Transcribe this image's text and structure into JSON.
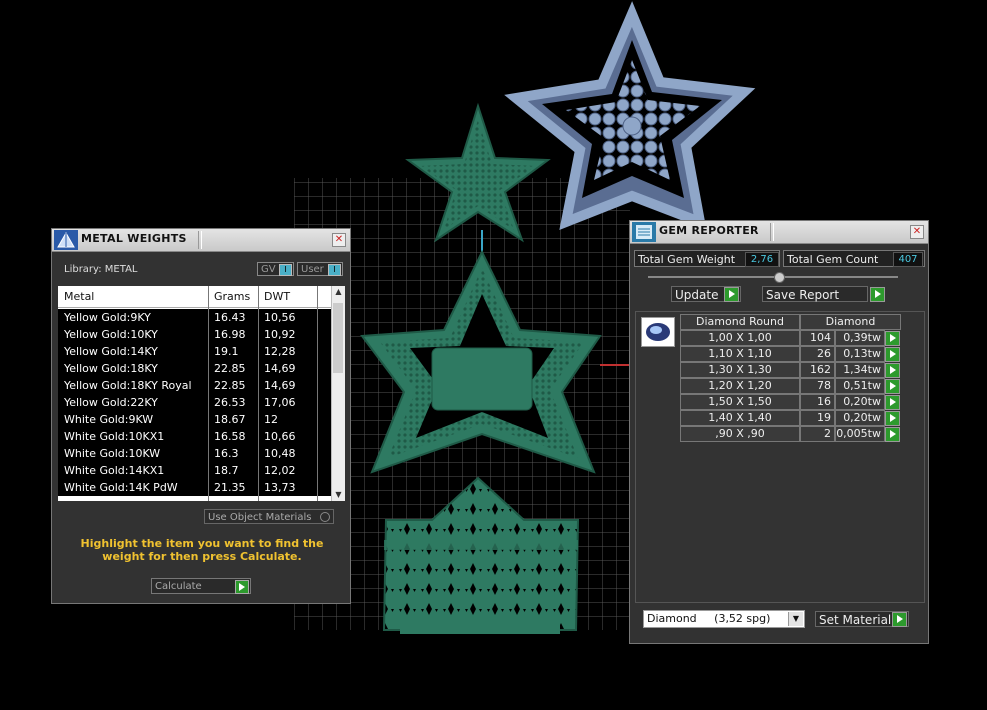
{
  "metal_weights": {
    "title": "METAL WEIGHTS",
    "library_label": "Library: METAL",
    "toggle_gv": "GV",
    "toggle_user": "User",
    "columns": [
      "Metal",
      "Grams",
      "DWT"
    ],
    "rows": [
      [
        "Yellow Gold:9KY",
        "16.43",
        "10,56"
      ],
      [
        "Yellow Gold:10KY",
        "16.98",
        "10,92"
      ],
      [
        "Yellow Gold:14KY",
        "19.1",
        "12,28"
      ],
      [
        "Yellow Gold:18KY",
        "22.85",
        "14,69"
      ],
      [
        "Yellow Gold:18KY Royal",
        "22.85",
        "14,69"
      ],
      [
        "Yellow Gold:22KY",
        "26.53",
        "17,06"
      ],
      [
        "White Gold:9KW",
        "18.67",
        "12"
      ],
      [
        "White Gold:10KX1",
        "16.58",
        "10,66"
      ],
      [
        "White Gold:10KW",
        "16.3",
        "10,48"
      ],
      [
        "White Gold:14KX1",
        "18.7",
        "12,02"
      ],
      [
        "White Gold:14K PdW",
        "21.35",
        "13,73"
      ]
    ],
    "use_object_materials": "Use Object Materials",
    "hint": "Highlight the item you want to find the weight for then press Calculate.",
    "calculate_label": "Calculate"
  },
  "gem_reporter": {
    "title": "GEM REPORTER",
    "total_weight_label": "Total Gem Weight",
    "total_weight_value": "2,76",
    "total_count_label": "Total Gem Count",
    "total_count_value": "407",
    "update_label": "Update",
    "save_report_label": "Save Report",
    "header_shape": "Diamond Round",
    "header_material": "Diamond",
    "rows": [
      [
        "1,00 X 1,00",
        "104",
        "0,39tw"
      ],
      [
        "1,10 X 1,10",
        "26",
        "0,13tw"
      ],
      [
        "1,30 X 1,30",
        "162",
        "1,34tw"
      ],
      [
        "1,20 X 1,20",
        "78",
        "0,51tw"
      ],
      [
        "1,50 X 1,50",
        "16",
        "0,20tw"
      ],
      [
        "1,40 X 1,40",
        "19",
        "0,20tw"
      ],
      [
        ",90 X ,90",
        "2",
        "0,005tw"
      ]
    ],
    "material_select": "Diamond     (3,52 spg)",
    "set_material_label": "Set Material"
  },
  "colors": {
    "background": "#000000",
    "model_green": "#2e7a62",
    "gem_blue": "#8fa6c8",
    "hint_text": "#f0c230",
    "value_cyan": "#4ac8e0"
  }
}
